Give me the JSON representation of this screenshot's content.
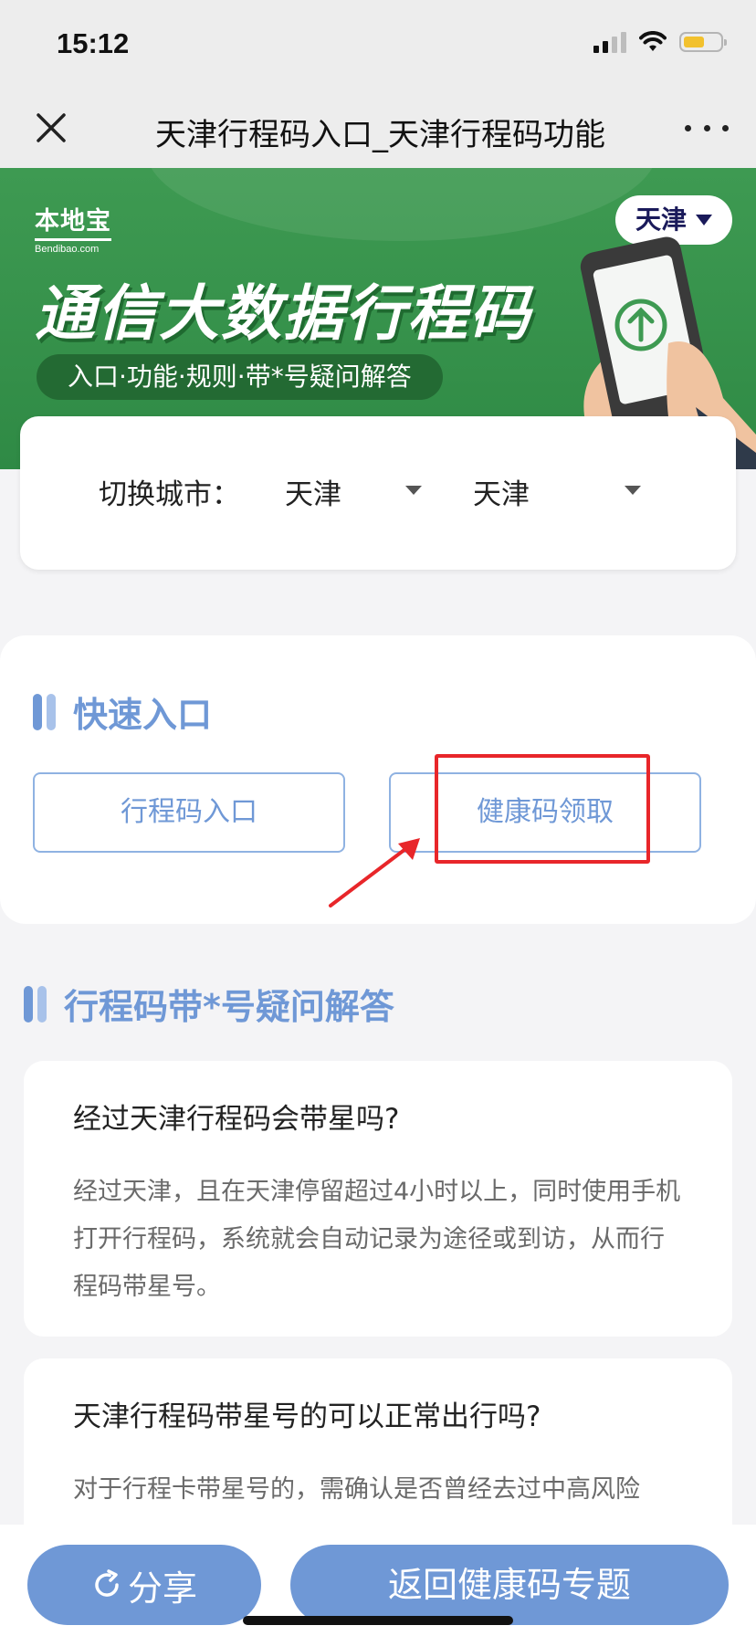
{
  "status": {
    "time": "15:12"
  },
  "nav": {
    "title": "天津行程码入口_天津行程码功能"
  },
  "banner": {
    "logo_main": "本地宝",
    "logo_sub": "Bendibao.com",
    "title": "通信大数据行程码",
    "subtitle": "入口·功能·规则·带*号疑问解答",
    "city": "天津"
  },
  "switch_city": {
    "label": "切换城市：",
    "province": "天津",
    "city": "天津"
  },
  "quick": {
    "title": "快速入口",
    "btn_trip": "行程码入口",
    "btn_health": "健康码领取"
  },
  "faq": {
    "title": "行程码带*号疑问解答",
    "items": [
      {
        "q": "经过天津行程码会带星吗?",
        "a": "经过天津，且在天津停留超过4小时以上，同时使用手机打开行程码，系统就会自动记录为途径或到访，从而行程码带星号。"
      },
      {
        "q": "天津行程码带星号的可以正常出行吗?",
        "a": "对于行程卡带星号的，需确认是否曾经去过中高风险"
      }
    ]
  },
  "bottom": {
    "share": "分享",
    "back": "返回健康码专题"
  },
  "colors": {
    "accent": "#6f98d6",
    "banner_green": "#3e9a52",
    "highlight_red": "#e8262a"
  }
}
